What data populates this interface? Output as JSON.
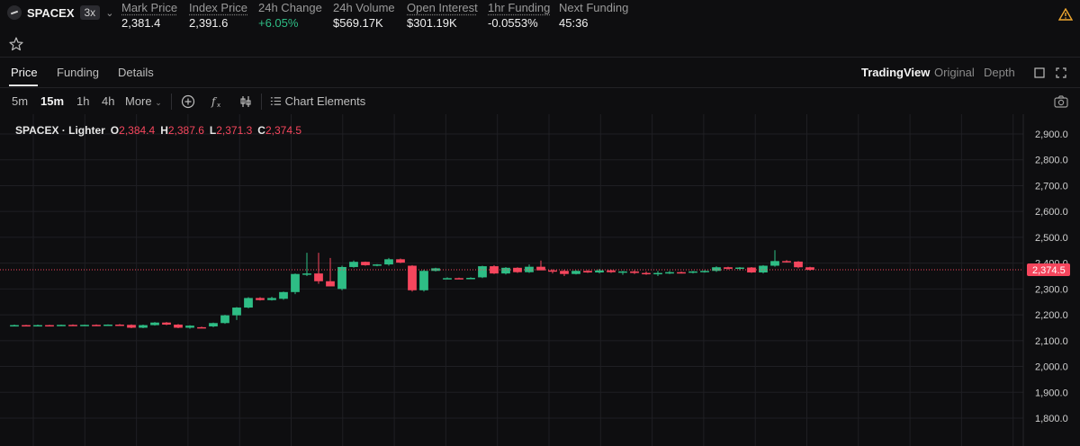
{
  "market": {
    "symbol": "SPACEX",
    "leverage": "3x",
    "stats": [
      {
        "label": "Mark Price",
        "value": "2,381.4",
        "dotted": true
      },
      {
        "label": "Index Price",
        "value": "2,391.6",
        "dotted": true
      },
      {
        "label": "24h Change",
        "value": "+6.05%",
        "dotted": false,
        "positive": true
      },
      {
        "label": "24h Volume",
        "value": "$569.17K",
        "dotted": false
      },
      {
        "label": "Open Interest",
        "value": "$301.19K",
        "dotted": true
      },
      {
        "label": "1hr Funding",
        "value": "-0.0553%",
        "dotted": true
      },
      {
        "label": "Next Funding",
        "value": "45:36",
        "dotted": false
      }
    ]
  },
  "tabs": [
    "Price",
    "Funding",
    "Details"
  ],
  "views": [
    "TradingView",
    "Original",
    "Depth"
  ],
  "timeframes": [
    "5m",
    "15m",
    "1h",
    "4h"
  ],
  "more_label": "More",
  "chart_elements_label": "Chart Elements",
  "legend": {
    "title": "SPACEX · Lighter",
    "o_key": "O",
    "o": "2,384.4",
    "h_key": "H",
    "h": "2,387.6",
    "l_key": "L",
    "l": "2,371.3",
    "c_key": "C",
    "c": "2,374.5"
  },
  "colors": {
    "up": "#2ebd85",
    "down": "#f6465d",
    "background": "#0e0e10",
    "grid": "#1f1f23"
  },
  "chart_data": {
    "type": "candlestick",
    "ylim": [
      1760,
      2960
    ],
    "y_ticks": [
      "2,900.0",
      "2,800.0",
      "2,700.0",
      "2,600.0",
      "2,500.0",
      "2,400.0",
      "2,300.0",
      "2,200.0",
      "2,100.0",
      "2,000.0",
      "1,900.0",
      "1,800.0"
    ],
    "y_tick_values": [
      2900,
      2800,
      2700,
      2600,
      2500,
      2400,
      2300,
      2200,
      2100,
      2000,
      1900,
      1800
    ],
    "last_price": 2374.5,
    "last_price_label": "2,374.5",
    "candles": [
      [
        2160,
        2162,
        2158,
        2160
      ],
      [
        2160,
        2161,
        2158,
        2159
      ],
      [
        2160,
        2162,
        2158,
        2160
      ],
      [
        2160,
        2161,
        2157,
        2159
      ],
      [
        2160,
        2162,
        2158,
        2161
      ],
      [
        2161,
        2163,
        2159,
        2160
      ],
      [
        2160,
        2162,
        2158,
        2161
      ],
      [
        2161,
        2163,
        2159,
        2160
      ],
      [
        2160,
        2163,
        2158,
        2162
      ],
      [
        2162,
        2164,
        2160,
        2161
      ],
      [
        2161,
        2163,
        2148,
        2150
      ],
      [
        2150,
        2162,
        2148,
        2160
      ],
      [
        2160,
        2172,
        2158,
        2170
      ],
      [
        2170,
        2172,
        2160,
        2162
      ],
      [
        2162,
        2164,
        2148,
        2150
      ],
      [
        2150,
        2160,
        2146,
        2158
      ],
      [
        2152,
        2154,
        2148,
        2150
      ],
      [
        2155,
        2170,
        2152,
        2168
      ],
      [
        2168,
        2200,
        2165,
        2198
      ],
      [
        2198,
        2230,
        2180,
        2228
      ],
      [
        2228,
        2268,
        2225,
        2265
      ],
      [
        2265,
        2268,
        2255,
        2257
      ],
      [
        2257,
        2270,
        2255,
        2265
      ],
      [
        2262,
        2290,
        2258,
        2288
      ],
      [
        2288,
        2360,
        2280,
        2358
      ],
      [
        2358,
        2440,
        2350,
        2360
      ],
      [
        2360,
        2440,
        2320,
        2330
      ],
      [
        2330,
        2420,
        2310,
        2310
      ],
      [
        2300,
        2390,
        2295,
        2385
      ],
      [
        2385,
        2410,
        2382,
        2405
      ],
      [
        2405,
        2406,
        2390,
        2392
      ],
      [
        2392,
        2396,
        2388,
        2395
      ],
      [
        2395,
        2420,
        2390,
        2415
      ],
      [
        2415,
        2418,
        2400,
        2402
      ],
      [
        2390,
        2392,
        2290,
        2295
      ],
      [
        2295,
        2375,
        2290,
        2370
      ],
      [
        2370,
        2382,
        2368,
        2380
      ],
      [
        2340,
        2345,
        2338,
        2342
      ],
      [
        2342,
        2344,
        2340,
        2341
      ],
      [
        2341,
        2345,
        2338,
        2343
      ],
      [
        2345,
        2390,
        2342,
        2388
      ],
      [
        2388,
        2392,
        2358,
        2360
      ],
      [
        2360,
        2385,
        2356,
        2382
      ],
      [
        2382,
        2384,
        2362,
        2365
      ],
      [
        2365,
        2395,
        2362,
        2386
      ],
      [
        2386,
        2410,
        2380,
        2372
      ],
      [
        2372,
        2376,
        2360,
        2370
      ],
      [
        2370,
        2375,
        2350,
        2358
      ],
      [
        2358,
        2372,
        2356,
        2370
      ],
      [
        2370,
        2373,
        2362,
        2364
      ],
      [
        2364,
        2378,
        2360,
        2372
      ],
      [
        2372,
        2375,
        2362,
        2365
      ],
      [
        2365,
        2370,
        2355,
        2368
      ],
      [
        2368,
        2372,
        2358,
        2362
      ],
      [
        2362,
        2368,
        2355,
        2360
      ],
      [
        2360,
        2370,
        2350,
        2362
      ],
      [
        2362,
        2370,
        2358,
        2365
      ],
      [
        2365,
        2368,
        2360,
        2363
      ],
      [
        2363,
        2370,
        2360,
        2368
      ],
      [
        2368,
        2372,
        2363,
        2370
      ],
      [
        2370,
        2388,
        2366,
        2384
      ],
      [
        2384,
        2386,
        2375,
        2378
      ],
      [
        2378,
        2385,
        2372,
        2383
      ],
      [
        2383,
        2385,
        2362,
        2364
      ],
      [
        2364,
        2392,
        2360,
        2390
      ],
      [
        2390,
        2450,
        2386,
        2408
      ],
      [
        2408,
        2412,
        2402,
        2406
      ],
      [
        2406,
        2408,
        2380,
        2384
      ],
      [
        2384,
        2386,
        2371,
        2374
      ]
    ]
  }
}
